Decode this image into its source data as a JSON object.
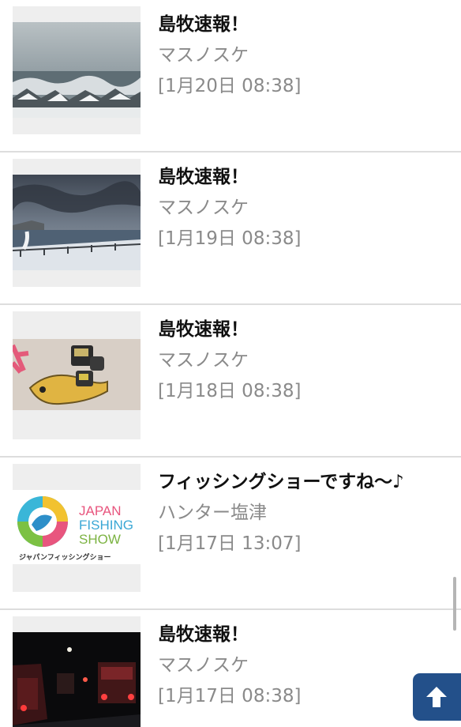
{
  "posts": [
    {
      "title": "島牧速報！",
      "author": "マスノスケ",
      "date": "[1月20日 08:38]",
      "image": "snowy-seawall-waves-photo"
    },
    {
      "title": "島牧速報！",
      "author": "マスノスケ",
      "date": "[1月19日 08:38]",
      "image": "snowy-coast-cloudy-sky-photo"
    },
    {
      "title": "島牧速報！",
      "author": "マスノスケ",
      "date": "[1月18日 08:38]",
      "image": "fishing-reel-parts-photo"
    },
    {
      "title": "フィッシングショーですね〜♪",
      "author": "ハンター塩津",
      "date": "[1月17日 13:07]",
      "image": "japan-fishing-show-logo"
    },
    {
      "title": "島牧速報！",
      "author": "マスノスケ",
      "date": "[1月17日 08:38]",
      "image": "night-road-traffic-photo"
    }
  ],
  "logo": {
    "line1": "JAPAN",
    "line2": "FISHING",
    "line3": "SHOW",
    "caption": "ジャパンフィッシングショー"
  },
  "icons": {
    "back_to_top": "arrow-up-icon"
  },
  "colors": {
    "title": "#111111",
    "meta": "#8a8a8a",
    "divider": "#dddddd",
    "top_button": "#23508a"
  }
}
